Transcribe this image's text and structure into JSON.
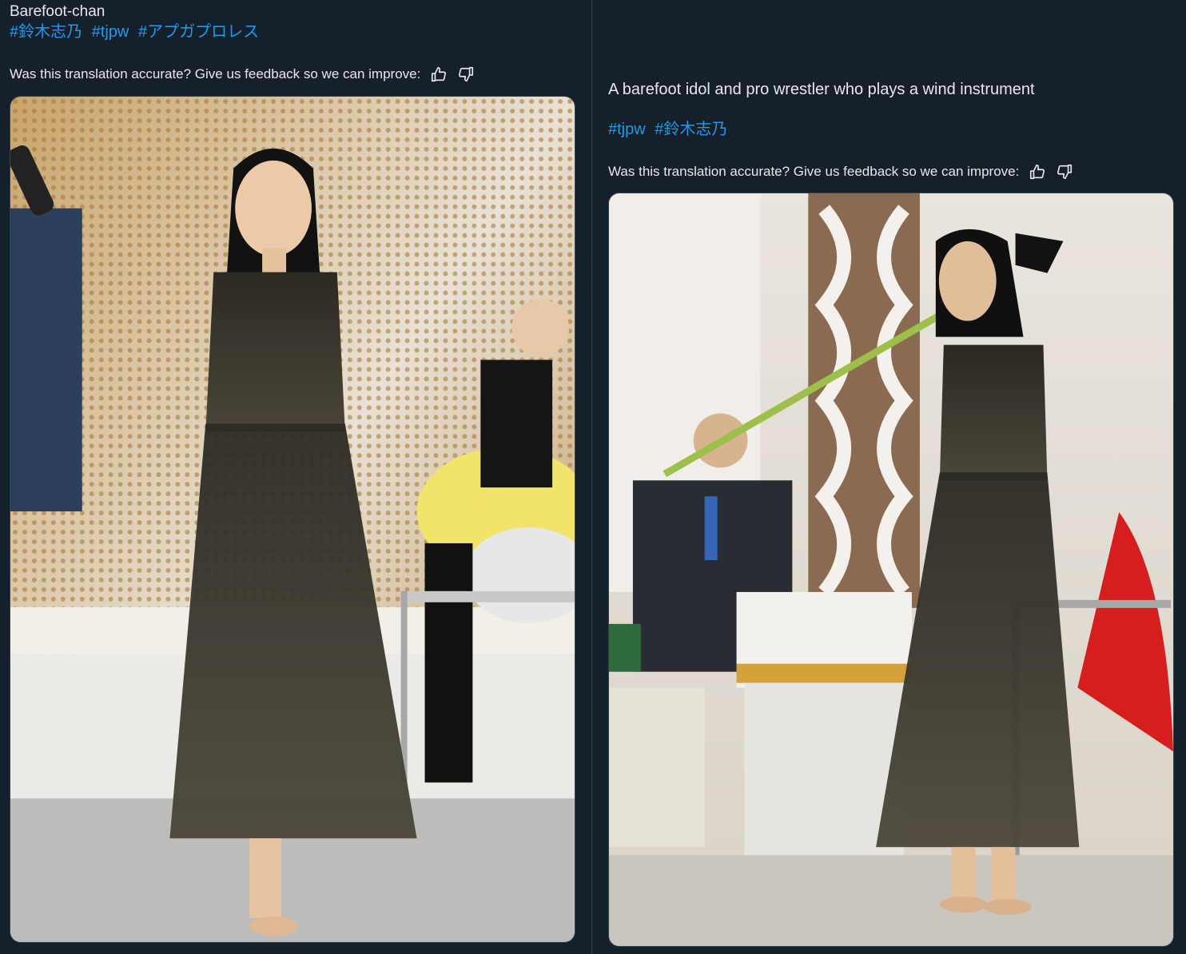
{
  "left_post": {
    "title": "Barefoot-chan",
    "hashtags": [
      "#鈴木志乃",
      "#tjpw",
      "#アプガプロレス"
    ],
    "feedback_prompt": "Was this translation accurate? Give us feedback so we can improve:",
    "thumbs_up_icon": "thumbs-up-icon",
    "thumbs_down_icon": "thumbs-down-icon",
    "photo_alt": "Woman in a long dark tulle dress walking barefoot on stage in front of a sequined curtain"
  },
  "right_post": {
    "title": "A barefoot idol and pro wrestler who plays a wind instrument",
    "hashtags": [
      "#tjpw",
      "#鈴木志乃"
    ],
    "feedback_prompt": "Was this translation accurate? Give us feedback so we can improve:",
    "thumbs_up_icon": "thumbs-up-icon",
    "thumbs_down_icon": "thumbs-down-icon",
    "photo_alt": "Woman in a dark dress standing barefoot on stage blowing a long green wind instrument"
  },
  "colors": {
    "background": "#15202b",
    "text": "#e7e9ea",
    "link": "#1d9bf0",
    "border": "#38444d"
  }
}
